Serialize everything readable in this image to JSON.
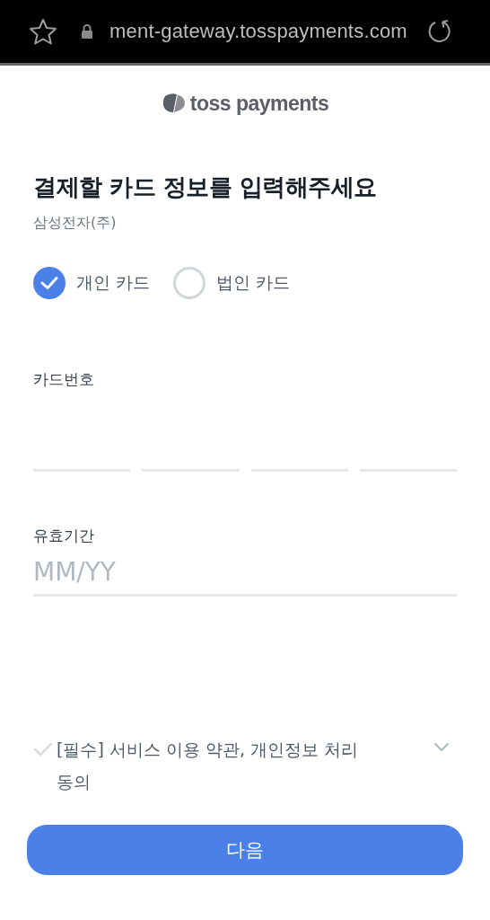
{
  "browser": {
    "url": "ment-gateway.tosspayments.com"
  },
  "logo": {
    "text": "toss payments"
  },
  "title": "결제할 카드 정보를 입력해주세요",
  "merchant": "삼성전자(주)",
  "card_types": [
    {
      "label": "개인 카드",
      "selected": true
    },
    {
      "label": "법인 카드",
      "selected": false
    }
  ],
  "card_number": {
    "label": "카드번호"
  },
  "expiry": {
    "label": "유효기간",
    "placeholder": "MM/YY"
  },
  "agreement": {
    "text": "[필수] 서비스 이용 약관, 개인정보 처리 동의",
    "checked": false
  },
  "next_button": "다음"
}
